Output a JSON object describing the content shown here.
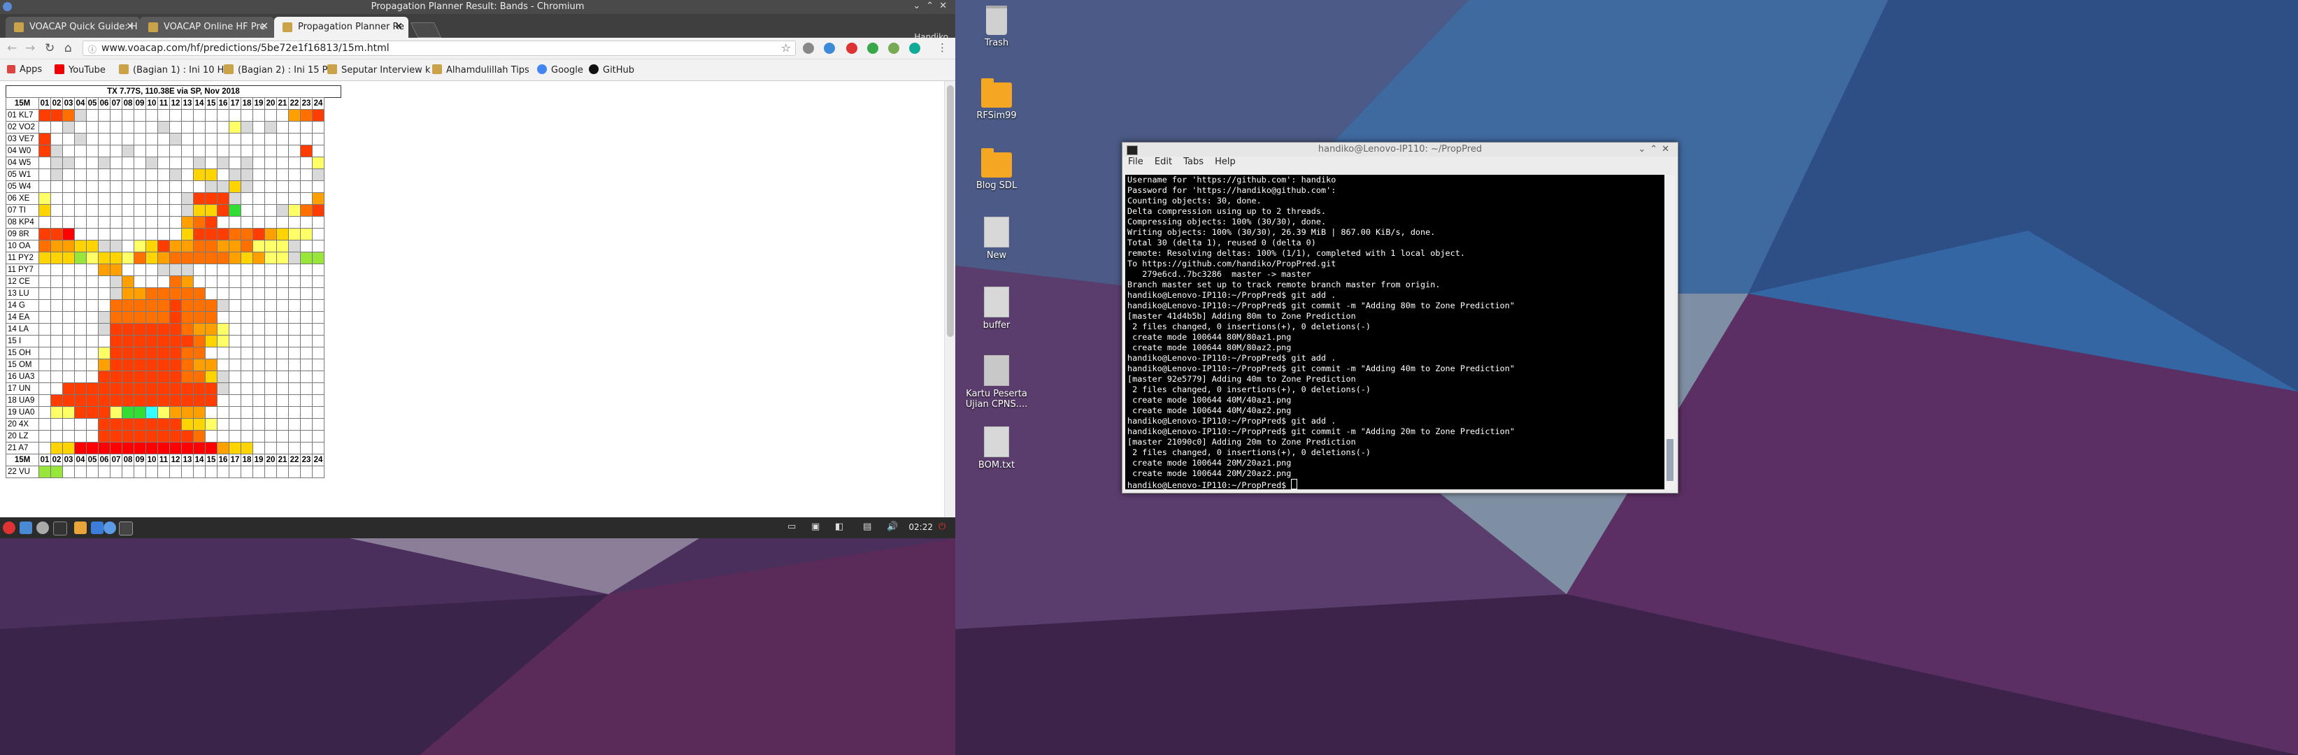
{
  "browser": {
    "window_title": "Propagation Planner Result: Bands - Chromium",
    "profile": "Handiko",
    "tabs": [
      {
        "label": "VOACAP Quick Guide: H"
      },
      {
        "label": "VOACAP Online HF Pre"
      },
      {
        "label": "Propagation Planner Re"
      }
    ],
    "url": "www.voacap.com/hf/predictions/5be72e1f16813/15m.html",
    "bookmarks": [
      {
        "label": "Apps"
      },
      {
        "label": "YouTube"
      },
      {
        "label": "(Bagian 1) : Ini 10 H"
      },
      {
        "label": "(Bagian 2) : Ini 15 P"
      },
      {
        "label": "Seputar Interview k"
      },
      {
        "label": "Alhamdulillah Tips"
      },
      {
        "label": "Google"
      },
      {
        "label": "GitHub"
      }
    ]
  },
  "prediction": {
    "title": "TX 7.77S, 110.38E via SP, Nov 2018",
    "band_label": "15M",
    "hours": [
      "01",
      "02",
      "03",
      "04",
      "05",
      "06",
      "07",
      "08",
      "09",
      "10",
      "11",
      "12",
      "13",
      "14",
      "15",
      "16",
      "17",
      "18",
      "19",
      "20",
      "21",
      "22",
      "23",
      "24"
    ],
    "zones": [
      "01 KL7",
      "02 VO2",
      "03 VE7",
      "04 W0",
      "04 W5",
      "05 W1",
      "05 W4",
      "06 XE",
      "07 TI",
      "08 KP4",
      "09 8R",
      "10 OA",
      "11 PY2",
      "11 PY7",
      "12 CE",
      "13 LU",
      "14 G",
      "14 EA",
      "14 LA",
      "15 I",
      "15 OH",
      "15 OM",
      "16 UA3",
      "17 UN",
      "18 UA9",
      "19 UA0",
      "20 4X",
      "20 LZ",
      "21 A7"
    ],
    "extra_zone": "22 VU",
    "level_colors": {
      "0": "#ffffff",
      "1": "#d9d9d9",
      "2": "#ffff66",
      "3": "#ffd400",
      "4": "#ffa000",
      "5": "#ff7000",
      "6": "#ff3d00",
      "7": "#ff0000",
      "8": "#99e63a",
      "9": "#33dd33",
      "a": "#33ffff"
    },
    "rows": [
      "665100000000000000000456",
      "001000000010000021010000",
      "600100000001000000000000",
      "610000010000000000000060",
      "011001000100010101000002",
      "010000000001033011000001",
      "000000000000001131000000",
      "200000000000166610000004",
      "300000000000133690001256",
      "000000000000456000000000",
      "667000000000366655643220",
      "544331102364455445222100",
      "333823325345555543422188",
      "339933223452334665231432",
      "334428120254655434432200",
      "555543253245551422231000",
      "000000000000000000000000",
      "000000000000000000000000",
      "000000000000000000000000",
      "000000000000000000000000",
      "000000000000000000000000",
      "000000000000000000000000",
      "000000000000000000000000",
      "000000000000000000000000",
      "000000000000000000000000",
      "000000000000000000000000",
      "000000000000000000000000",
      "000000000000000000000000",
      "000000000000000000000000"
    ],
    "rows_lower": [
      "000004400011100000000000",
      "000000140005400000000000",
      "000000144555550000000000",
      "000000555556555100000000",
      "000001555556555000000000",
      "000001666666544200000000",
      "000000666666653200000000",
      "000002666666550000000000",
      "000004666666544000000000",
      "000006666666553100000000",
      "006666666666666100000000",
      "066666666666666000000000",
      "022666299a2444000000000",
      "000006666666332000000000",
      "000006666666650000000000",
      "033777777777777433000000"
    ],
    "extra_row": "880000000000000000000000"
  },
  "taskbar": {
    "clock": "02:22"
  },
  "desktop": {
    "icons": [
      {
        "label": "Trash"
      },
      {
        "label": "RFSim99"
      },
      {
        "label": "Blog SDL"
      },
      {
        "label": "New"
      },
      {
        "label": "buffer"
      },
      {
        "label": "Kartu Peserta Ujian CPNS...."
      },
      {
        "label": "BOM.txt"
      }
    ]
  },
  "terminal": {
    "title": "handiko@Lenovo-IP110: ~/PropPred",
    "menu": [
      "File",
      "Edit",
      "Tabs",
      "Help"
    ],
    "lines": [
      "Username for 'https://github.com': handiko",
      "Password for 'https://handiko@github.com':",
      "Counting objects: 30, done.",
      "Delta compression using up to 2 threads.",
      "Compressing objects: 100% (30/30), done.",
      "Writing objects: 100% (30/30), 26.39 MiB | 867.00 KiB/s, done.",
      "Total 30 (delta 1), reused 0 (delta 0)",
      "remote: Resolving deltas: 100% (1/1), completed with 1 local object.",
      "To https://github.com/handiko/PropPred.git",
      "   279e6cd..7bc3286  master -> master",
      "Branch master set up to track remote branch master from origin.",
      "handiko@Lenovo-IP110:~/PropPred$ git add .",
      "handiko@Lenovo-IP110:~/PropPred$ git commit -m \"Adding 80m to Zone Prediction\"",
      "[master 41d4b5b] Adding 80m to Zone Prediction",
      " 2 files changed, 0 insertions(+), 0 deletions(-)",
      " create mode 100644 80M/80az1.png",
      " create mode 100644 80M/80az2.png",
      "handiko@Lenovo-IP110:~/PropPred$ git add .",
      "handiko@Lenovo-IP110:~/PropPred$ git commit -m \"Adding 40m to Zone Prediction\"",
      "[master 92e5779] Adding 40m to Zone Prediction",
      " 2 files changed, 0 insertions(+), 0 deletions(-)",
      " create mode 100644 40M/40az1.png",
      " create mode 100644 40M/40az2.png",
      "handiko@Lenovo-IP110:~/PropPred$ git add .",
      "handiko@Lenovo-IP110:~/PropPred$ git commit -m \"Adding 20m to Zone Prediction\"",
      "[master 21090c0] Adding 20m to Zone Prediction",
      " 2 files changed, 0 insertions(+), 0 deletions(-)",
      " create mode 100644 20M/20az1.png",
      " create mode 100644 20M/20az2.png",
      "handiko@Lenovo-IP110:~/PropPred$ "
    ]
  }
}
